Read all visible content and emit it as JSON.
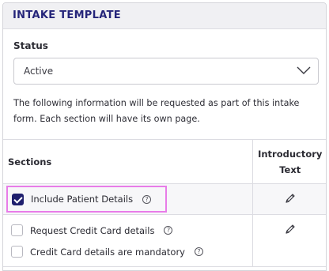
{
  "header": {
    "title": "INTAKE TEMPLATE"
  },
  "status": {
    "label": "Status",
    "value": "Active"
  },
  "description": "The following information will be requested as part of this intake form. Each section will have its own page.",
  "table": {
    "headers": {
      "sections": "Sections",
      "intro_line1": "Introductory",
      "intro_line2": "Text"
    },
    "rows": [
      {
        "label": "Include Patient Details",
        "checked": true
      },
      {
        "label": "Request Credit Card details",
        "checked": false
      },
      {
        "label": "Credit Card details are mandatory",
        "checked": false
      }
    ]
  },
  "icons": {
    "help": "question-circle-icon",
    "edit": "pencil-icon",
    "dropdown": "chevron-down-icon"
  },
  "colors": {
    "accent": "#1f1f6e",
    "header_text": "#25257a",
    "highlight": "#e87ce8"
  }
}
